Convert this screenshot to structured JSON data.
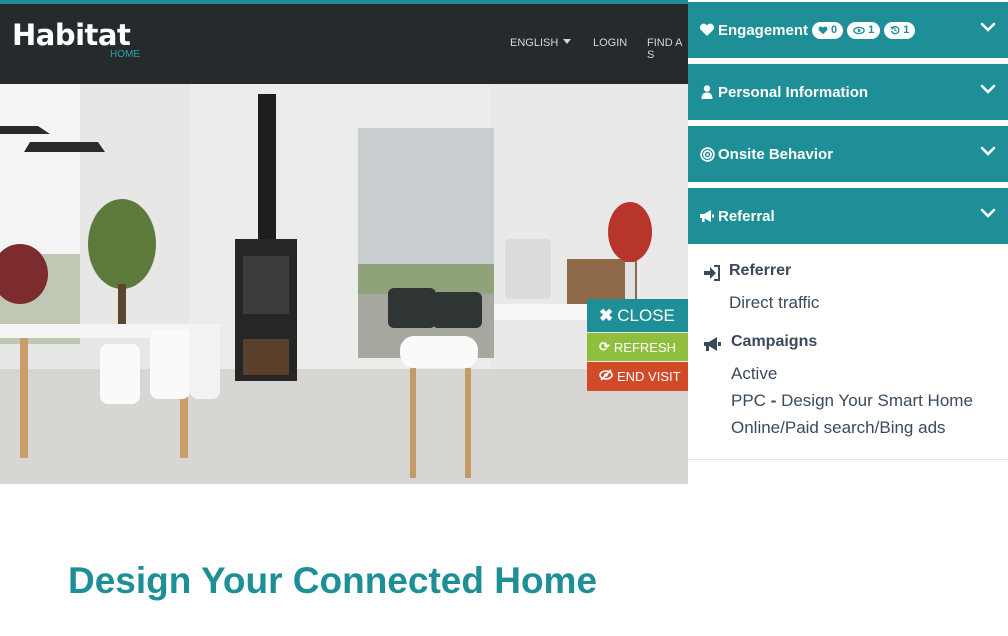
{
  "header": {
    "logo": "Habitat",
    "logo_sub": "HOME",
    "nav": {
      "language": "ENGLISH",
      "login": "LOGIN",
      "find": "FIND A S"
    }
  },
  "hero": {
    "image": "kitchen-interior-photo"
  },
  "buttons": {
    "close": "CLOSE",
    "refresh": "REFRESH",
    "end_visit": "END VISIT"
  },
  "panel": {
    "accordions": [
      {
        "label": "Engagement",
        "icon": "heart-icon"
      },
      {
        "label": "Personal Information",
        "icon": "person-icon"
      },
      {
        "label": "Onsite Behavior",
        "icon": "target-icon"
      },
      {
        "label": "Referral",
        "icon": "megaphone-icon"
      }
    ],
    "engagement_badges": [
      {
        "icon": "heart-icon",
        "count": "0"
      },
      {
        "icon": "eye-icon",
        "count": "1"
      },
      {
        "icon": "history-icon",
        "count": "1"
      }
    ],
    "referral": {
      "referrer_title": "Referrer",
      "referrer_value": "Direct traffic",
      "campaigns_title": "Campaigns",
      "campaign_status": "Active",
      "campaign_name_prefix": "PPC",
      "campaign_name_sep": " - ",
      "campaign_name": "Design Your Smart Home",
      "campaign_channel": "Online/Paid search/Bing ads"
    }
  },
  "main": {
    "heading": "Design Your Connected Home"
  },
  "colors": {
    "teal": "#1e8f97",
    "green": "#8fbf3c",
    "red": "#d24b29",
    "header": "#252a2c"
  }
}
